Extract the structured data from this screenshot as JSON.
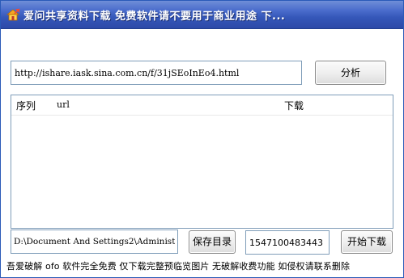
{
  "window": {
    "title": "爱问共享资料下载 免费软件请不要用于商业用途 下..."
  },
  "icons": {
    "app": "house-arrow-icon"
  },
  "colors": {
    "titlebar": "#3557b9",
    "window_bg": "#ffffff",
    "input_border": "#7f9db9"
  },
  "url_field": {
    "value": "http://ishare.iask.sina.com.cn/f/31jSEoInEo4.html"
  },
  "buttons": {
    "analyze": "分析",
    "save_dir": "保存目录",
    "start_download": "开始下载"
  },
  "list": {
    "columns": [
      "序列",
      "url",
      "下载"
    ],
    "rows": []
  },
  "path_field": {
    "value": "D:\\Document And Settings2\\Administ"
  },
  "code_field": {
    "value": "1547100483443"
  },
  "status_text": "吾爱破解 ofo 软件完全免费 仅下载完整预临览图片 无破解收费功能 如侵权请联系删除"
}
